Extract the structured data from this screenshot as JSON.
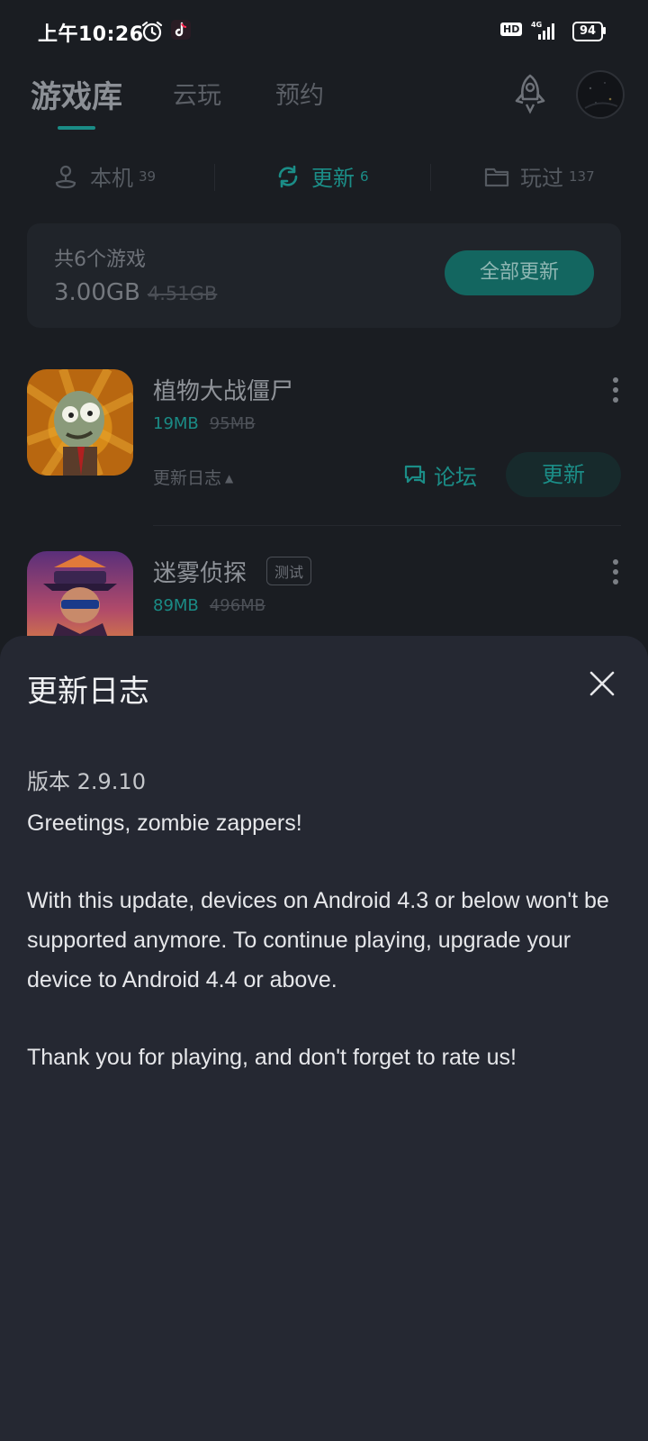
{
  "status_bar": {
    "time": "上午10:26",
    "hd_label": "HD",
    "network_label": "4G",
    "battery_level": "94"
  },
  "header": {
    "tabs": [
      {
        "label": "游戏库",
        "active": true
      },
      {
        "label": "云玩",
        "active": false
      },
      {
        "label": "预约",
        "active": false
      }
    ]
  },
  "filters": [
    {
      "label": "本机",
      "count": "39",
      "active": false
    },
    {
      "label": "更新",
      "count": "6",
      "active": true
    },
    {
      "label": "玩过",
      "count": "137",
      "active": false
    }
  ],
  "summary": {
    "total_label": "共6个游戏",
    "size_new": "3.00GB",
    "size_old": "4.51GB",
    "update_all_label": "全部更新"
  },
  "games": [
    {
      "title": "植物大战僵尸",
      "size_new": "19MB",
      "size_old": "95MB",
      "changelog_label": "更新日志",
      "forum_label": "论坛",
      "update_label": "更新"
    },
    {
      "title": "迷雾侦探",
      "badge": "测试",
      "size_new": "89MB",
      "size_old": "496MB"
    }
  ],
  "changelog_sheet": {
    "title": "更新日志",
    "version": "版本 2.9.10",
    "paragraphs": [
      "Greetings, zombie zappers!",
      "With this update, devices on Android 4.3 or below won't be supported anymore. To continue playing, upgrade your device to Android 4.4 or above.",
      "Thank you for playing, and don't forget to rate us!"
    ]
  },
  "colors": {
    "accent": "#1b8d87",
    "background": "#1a1d22",
    "sheet": "#252832"
  }
}
